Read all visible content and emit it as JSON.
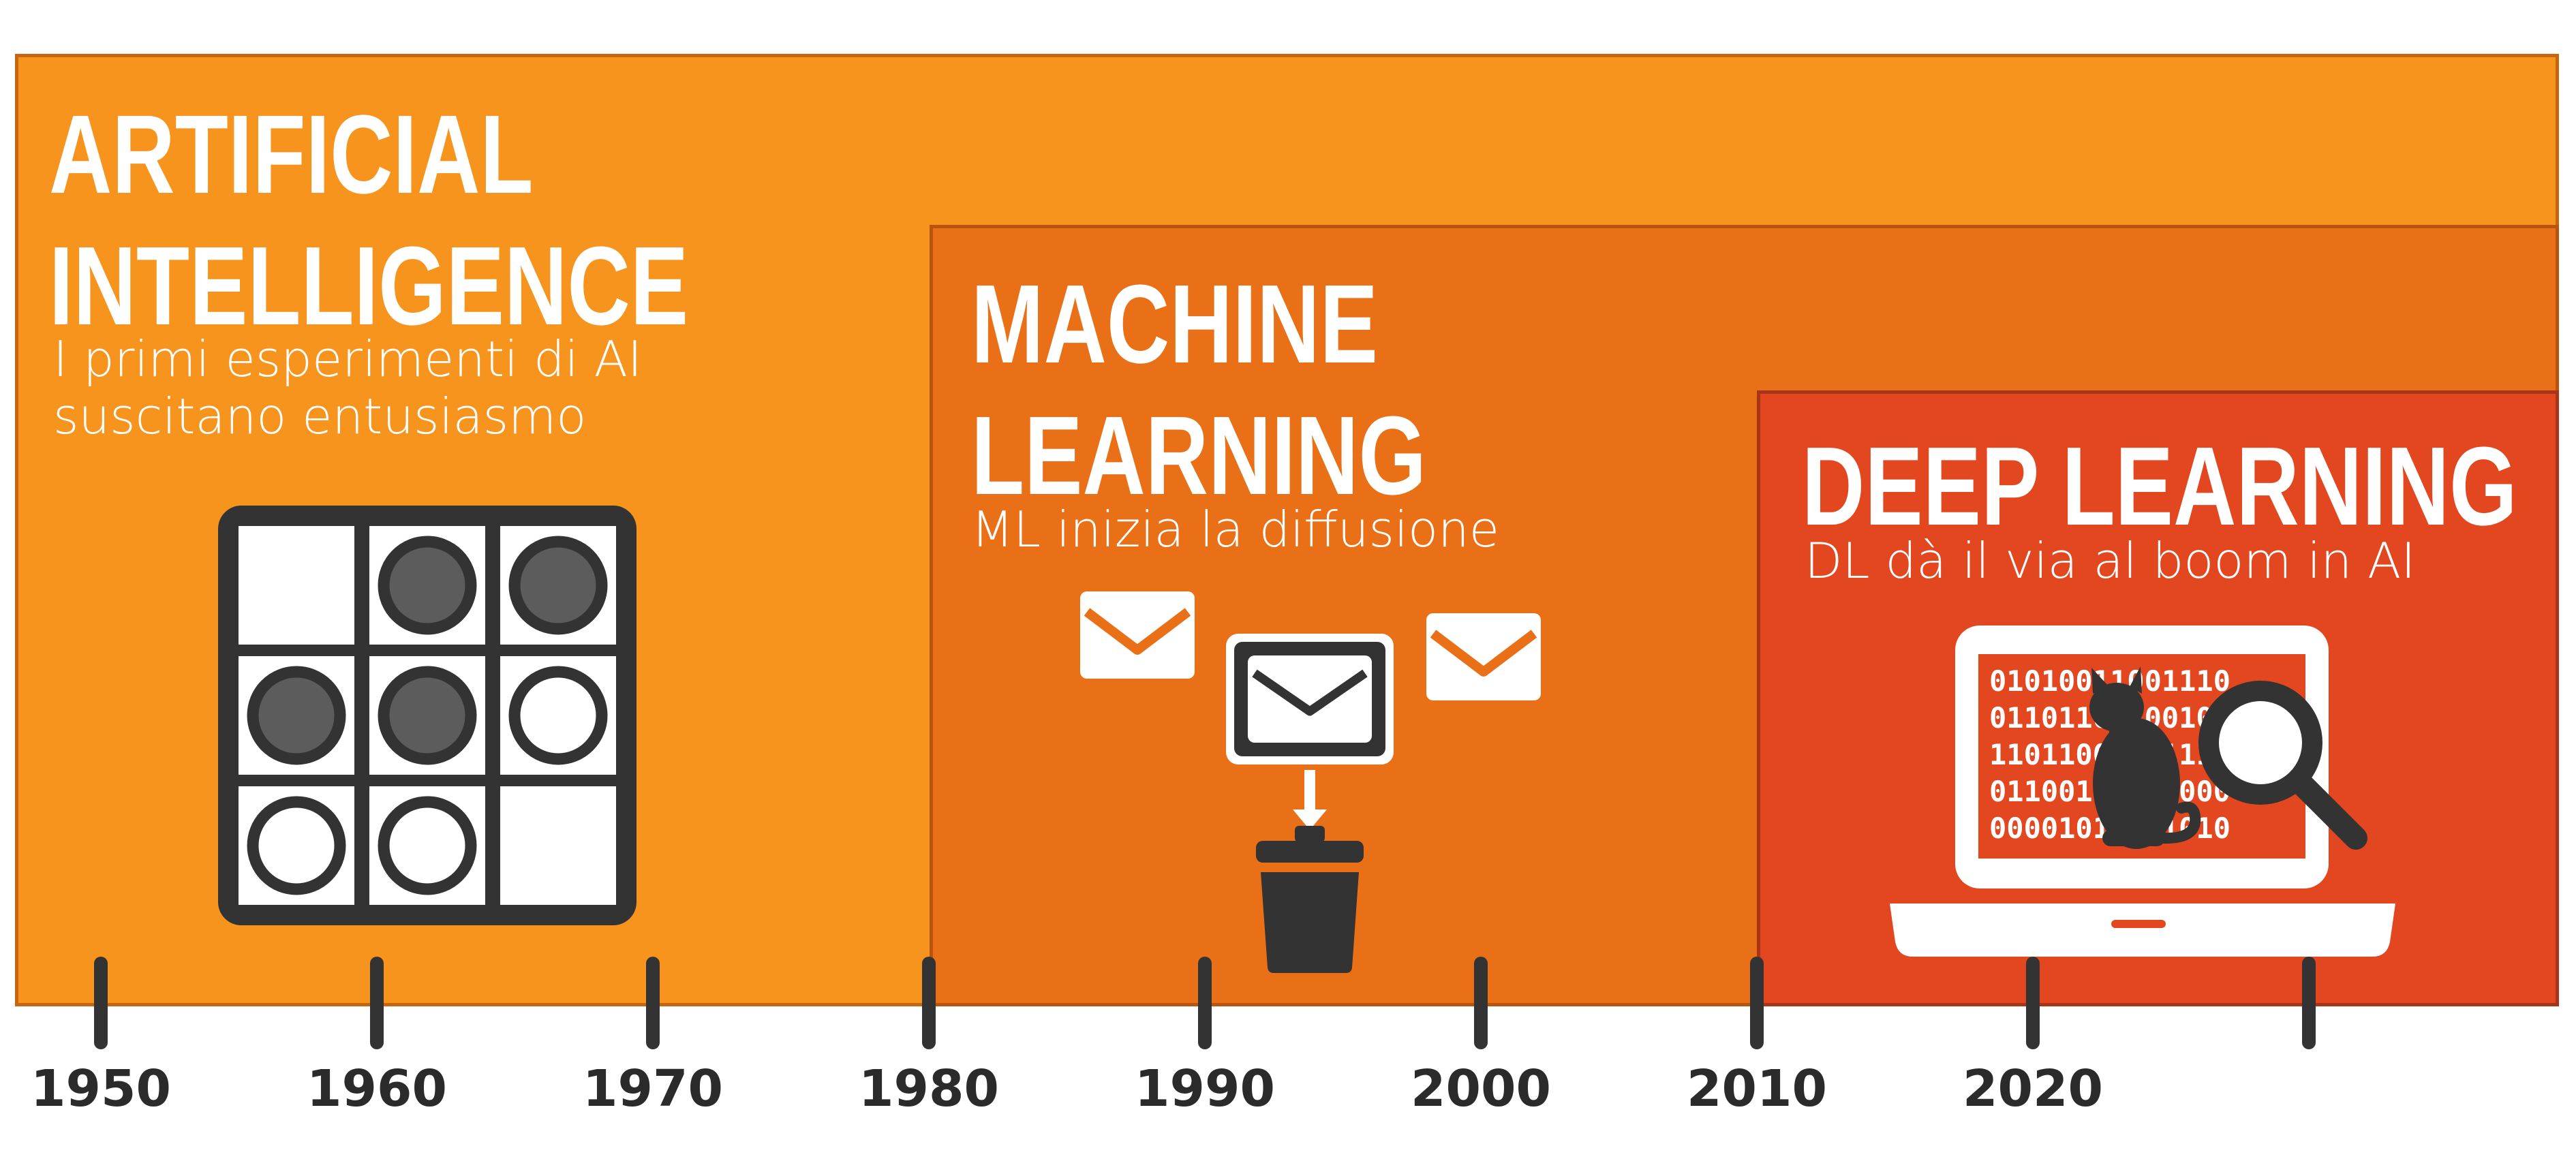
{
  "panels": {
    "ai": {
      "title_line1": "ARTIFICIAL",
      "title_line2": "INTELLIGENCE",
      "subtitle_line1": "I primi esperimenti di AI",
      "subtitle_line2": "suscitano entusiasmo",
      "icon": "checkers-board-icon"
    },
    "ml": {
      "title_line1": "MACHINE",
      "title_line2": "LEARNING",
      "subtitle": "ML inizia la diffusione",
      "icon": "email-spam-filter-icon"
    },
    "dl": {
      "title": "DEEP LEARNING",
      "subtitle": "DL dà il via al boom in AI",
      "icon": "laptop-cat-recognition-icon"
    }
  },
  "binary_text": [
    "01010011001110",
    "01101100100100",
    "11011000101110",
    "01100100011000",
    "00001010001010"
  ],
  "timeline": {
    "years": [
      "1950",
      "1960",
      "1970",
      "1980",
      "1990",
      "2000",
      "2010",
      "2020"
    ]
  },
  "colors": {
    "ai": "#F7941D",
    "ml": "#E97016",
    "dl": "#E2471F",
    "dark": "#333333"
  }
}
